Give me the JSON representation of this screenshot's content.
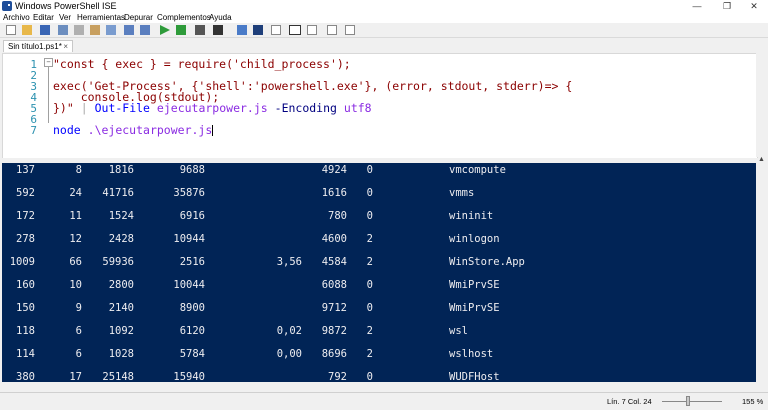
{
  "window": {
    "title": "Windows PowerShell ISE",
    "minimize": "—",
    "restore": "❐",
    "close": "✕"
  },
  "menu": [
    "Archivo",
    "Editar",
    "Ver",
    "Herramientas",
    "Depurar",
    "Complementos",
    "Ayuda"
  ],
  "tab": {
    "label": "Sin título1.ps1*",
    "close": "×"
  },
  "editor": {
    "lines": [
      {
        "n": "1",
        "text": "\"const { exec } = require('child_process');"
      },
      {
        "n": "2",
        "text": ""
      },
      {
        "n": "3",
        "text": "exec('Get-Process', {'shell':'powershell.exe'}, (error, stdout, stderr)=> {"
      },
      {
        "n": "4",
        "text": "    console.log(stdout);"
      },
      {
        "n": "5",
        "text": "})\""
      },
      {
        "n": "6",
        "text": ""
      },
      {
        "n": "7",
        "text": "node .\\ejecutarpower.js"
      }
    ],
    "line5_pipe": "|",
    "line5_cmd": "Out-File",
    "line5_arg": "ejecutarpower.js",
    "line5_param": "-Encoding",
    "line5_val": "utf8",
    "line7_cmd": "node",
    "line7_arg": ".\\ejecutarpower.js"
  },
  "console": {
    "rows": [
      [
        "137",
        "8",
        "1816",
        "9688",
        "",
        "4924",
        "0",
        "vmcompute"
      ],
      [
        "592",
        "24",
        "41716",
        "35876",
        "",
        "1616",
        "0",
        "vmms"
      ],
      [
        "172",
        "11",
        "1524",
        "6916",
        "",
        "780",
        "0",
        "wininit"
      ],
      [
        "278",
        "12",
        "2428",
        "10944",
        "",
        "4600",
        "2",
        "winlogon"
      ],
      [
        "1009",
        "66",
        "59936",
        "2516",
        "3,56",
        "4584",
        "2",
        "WinStore.App"
      ],
      [
        "160",
        "10",
        "2800",
        "10044",
        "",
        "6088",
        "0",
        "WmiPrvSE"
      ],
      [
        "150",
        "9",
        "2140",
        "8900",
        "",
        "9712",
        "0",
        "WmiPrvSE"
      ],
      [
        "118",
        "6",
        "1092",
        "6120",
        "0,02",
        "9872",
        "2",
        "wsl"
      ],
      [
        "114",
        "6",
        "1028",
        "5784",
        "0,00",
        "8696",
        "2",
        "wslhost"
      ],
      [
        "380",
        "17",
        "25148",
        "15940",
        "",
        "792",
        "0",
        "WUDFHost"
      ]
    ]
  },
  "status": {
    "position": "Lín. 7  Col. 24",
    "zoom": "155 %",
    "zoom_fraction": 0.4
  }
}
